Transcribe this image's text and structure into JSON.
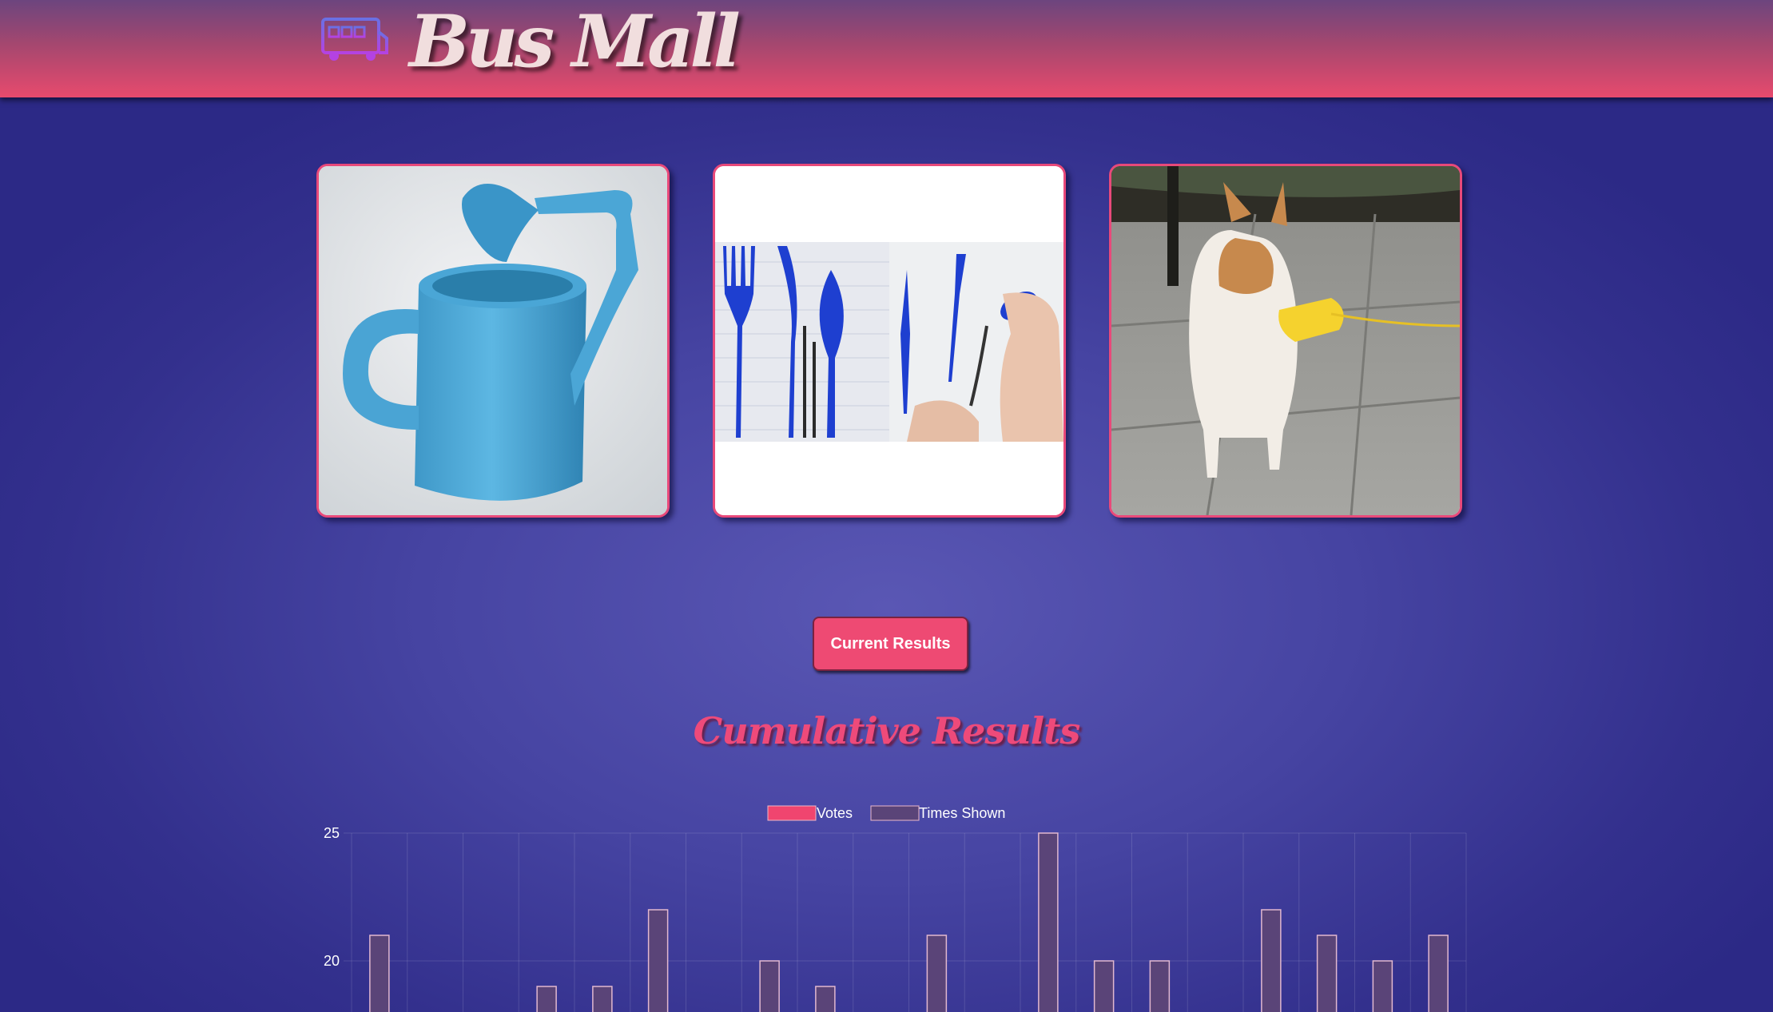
{
  "header": {
    "title": "Bus Mall",
    "logo_icon": "bus-icon"
  },
  "products": [
    {
      "name": "watering-can",
      "icon": "watering-can-image"
    },
    {
      "name": "pen-utensils",
      "icon": "pen-utensils-image"
    },
    {
      "name": "dog-duck",
      "icon": "dog-duck-muzzle-image"
    }
  ],
  "results_button": {
    "label": "Current Results"
  },
  "results": {
    "title": "Cumulative Results"
  },
  "colors": {
    "votes": "#f0456f",
    "times_shown": "#5a4478",
    "accent": "#e8497a"
  },
  "chart_data": {
    "type": "bar",
    "legend": [
      "Votes",
      "Times Shown"
    ],
    "legend_position": "top-center",
    "grid": true,
    "ylim_visible": [
      17,
      25
    ],
    "y_ticks": [
      "25",
      "20"
    ],
    "series": [
      {
        "name": "Votes",
        "values": []
      },
      {
        "name": "Times Shown",
        "values": [
          21,
          null,
          null,
          19,
          19,
          22,
          null,
          20,
          19,
          null,
          21,
          null,
          25,
          20,
          20,
          null,
          22,
          21,
          20,
          21
        ]
      }
    ]
  }
}
